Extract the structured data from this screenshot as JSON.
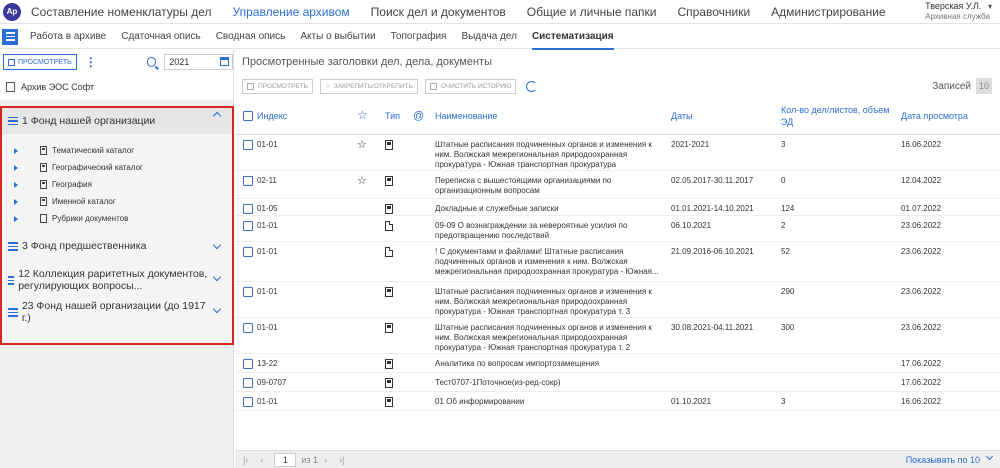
{
  "app": {
    "logo": "Ар"
  },
  "topnav": [
    {
      "label": "Составление номенклатуры дел",
      "active": false
    },
    {
      "label": "Управление архивом",
      "active": true
    },
    {
      "label": "Поиск дел и документов",
      "active": false
    },
    {
      "label": "Общие и личные папки",
      "active": false
    },
    {
      "label": "Справочники",
      "active": false
    },
    {
      "label": "Администрирование",
      "active": false
    }
  ],
  "user": {
    "name": "Тверская У.Л.",
    "role": "Архивная служба"
  },
  "subnav": [
    {
      "label": "Работа в архиве",
      "active": false
    },
    {
      "label": "Сдаточная опись",
      "active": false
    },
    {
      "label": "Сводная опись",
      "active": false
    },
    {
      "label": "Акты о выбытии",
      "active": false
    },
    {
      "label": "Топография",
      "active": false
    },
    {
      "label": "Выдача дел",
      "active": false
    },
    {
      "label": "Систематизация",
      "active": true
    }
  ],
  "left": {
    "view_button": "ПРОСМОТРЕТЬ",
    "year": "2021",
    "archive": "Архив ЭОС Софт",
    "fonds": [
      {
        "title": "1 Фонд нашей организации",
        "expanded": true
      },
      {
        "title": "3 Фонд предшественника",
        "expanded": false
      },
      {
        "title": "12 Коллекция раритетных документов, регулирующих вопросы...",
        "expanded": false
      },
      {
        "title": "23 Фонд нашей организации (до 1917 г.)",
        "expanded": false
      }
    ],
    "catalogs": [
      {
        "label": "Тематический каталог",
        "has_children": true
      },
      {
        "label": "Географический каталог",
        "has_children": true
      },
      {
        "label": "География",
        "has_children": true
      },
      {
        "label": "Именной каталог",
        "has_children": true
      },
      {
        "label": "Рубрики документов",
        "has_children": true
      }
    ]
  },
  "right": {
    "title": "Просмотренные заголовки дел, дела, документы",
    "toolbar": {
      "view": "ПРОСМОТРЕТЬ",
      "pin": "ЗАКРЕПИТЬ/ОТКРЕПИТЬ",
      "clear": "ОЧИСТИТЬ ИСТОРИЮ"
    },
    "records_label": "Записей",
    "records_count": "10",
    "columns": {
      "index": "Индекс",
      "type": "Тип",
      "at": "@",
      "name": "Наименование",
      "dates": "Даты",
      "count": "Кол-во дел/листов, объем ЭД",
      "viewed": "Дата просмотра"
    },
    "rows": [
      {
        "index": "01-01",
        "star": true,
        "type": "filled",
        "name": "Штатные расписания подчиненных органов и изменения к ним. Волжская межрегиональная природоохранная прокуратура - Южная транспортная прокуратура",
        "dates": "2021-2021",
        "count": "3",
        "viewed": "16.06.2022"
      },
      {
        "index": "02-11",
        "star": true,
        "type": "filled",
        "name": "Переписка с вышестоящими организациями по организационным вопросам",
        "dates": "02.05.2017-30.11.2017",
        "count": "0",
        "viewed": "12.04.2022"
      },
      {
        "index": "01-05",
        "star": false,
        "type": "filled",
        "name": "Докладные и служебные записки",
        "dates": "01.01.2021-14.10.2021",
        "count": "124",
        "viewed": "01.07.2022"
      },
      {
        "index": "01-01",
        "star": false,
        "type": "page",
        "name": "09-09 О вознаграждении за невероятные усилия по предотвращению последствий",
        "dates": "06.10.2021",
        "count": "2",
        "viewed": "23.06.2022"
      },
      {
        "index": "01-01",
        "star": false,
        "type": "page",
        "name": "! С документами и файлами! Штатные расписания подчиненных органов и изменения к ним. Волжская межрегиональная природоохранная прокуратура - Южная...",
        "dates": "21.09.2016-06.10.2021",
        "count": "52",
        "viewed": "23.06.2022"
      },
      {
        "index": "01-01",
        "star": false,
        "type": "filled",
        "name": "Штатные расписания подчиненных органов и изменения к ним. Волжская межрегиональная природоохранная прокуратура - Южная транспортная прокуратура т. 3",
        "dates": "",
        "count": "290",
        "viewed": "23.06.2022"
      },
      {
        "index": "01-01",
        "star": false,
        "type": "filled",
        "name": "Штатные расписания подчиненных органов и изменения к ним. Волжская межрегиональная природоохранная прокуратура - Южная транспортная прокуратура т. 2",
        "dates": "30.08.2021-04.11.2021",
        "count": "300",
        "viewed": "23.06.2022"
      },
      {
        "index": "13-22",
        "star": false,
        "type": "filled",
        "name": "Аналитика по вопросам импортозамещения",
        "dates": "",
        "count": "",
        "viewed": "17.06.2022"
      },
      {
        "index": "09-0707",
        "star": false,
        "type": "filled",
        "name": "Тест0707-1Поточное(из-ред-сокр)",
        "dates": "",
        "count": "",
        "viewed": "17.06.2022"
      },
      {
        "index": "01-01",
        "star": false,
        "type": "filled",
        "name": "01 Об информировании",
        "dates": "01.10.2021",
        "count": "3",
        "viewed": "16.06.2022"
      }
    ]
  },
  "footer": {
    "page": "1",
    "of": "из 1",
    "show": "Показывать по 10"
  }
}
